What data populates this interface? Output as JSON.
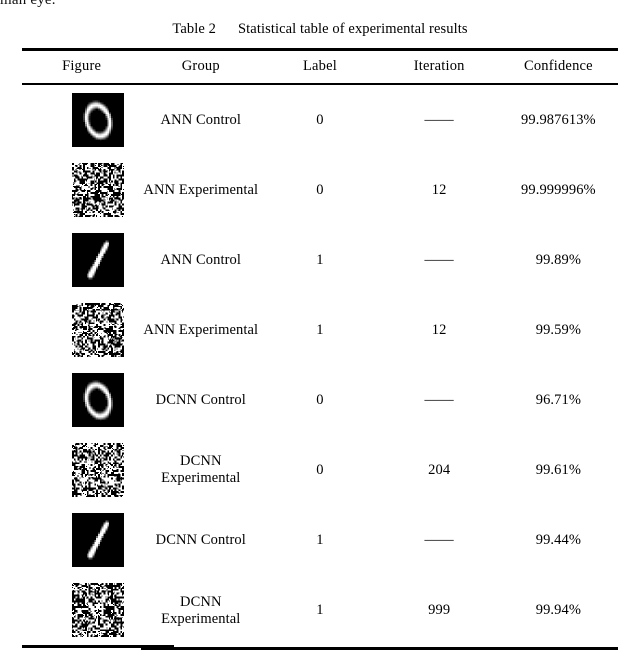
{
  "pretext": "man eye.",
  "caption": {
    "label": "Table 2",
    "title": "Statistical table of experimental results"
  },
  "table": {
    "columns": [
      "Figure",
      "Group",
      "Label",
      "Iteration",
      "Confidence"
    ],
    "rows": [
      {
        "figure": "digit-zero-clean",
        "group": "ANN Control",
        "label": "0",
        "iteration": "——",
        "confidence": "99.987613%"
      },
      {
        "figure": "digit-zero-adversarial-noise",
        "group": "ANN Experimental",
        "label": "0",
        "iteration": "12",
        "confidence": "99.999996%"
      },
      {
        "figure": "digit-one-clean",
        "group": "ANN Control",
        "label": "1",
        "iteration": "——",
        "confidence": "99.89%"
      },
      {
        "figure": "digit-one-adversarial-noise",
        "group": "ANN Experimental",
        "label": "1",
        "iteration": "12",
        "confidence": "99.59%"
      },
      {
        "figure": "digit-zero-clean",
        "group": "DCNN Control",
        "label": "0",
        "iteration": "——",
        "confidence": "96.71%"
      },
      {
        "figure": "digit-zero-adversarial-noise",
        "group": "DCNN Experimental",
        "label": "0",
        "iteration": "204",
        "confidence": "99.61%"
      },
      {
        "figure": "digit-one-clean",
        "group": "DCNN Control",
        "label": "1",
        "iteration": "——",
        "confidence": "99.44%"
      },
      {
        "figure": "digit-one-adversarial-noise",
        "group": "DCNN Experimental",
        "label": "1",
        "iteration": "999",
        "confidence": "99.94%"
      }
    ]
  },
  "colors": {
    "rule": "#000000",
    "text": "#000000",
    "figure_background_clean": "#000000",
    "figure_stroke_clean": "#ffffff",
    "figure_background_noise": "#ffffff",
    "figure_stroke_noise": "#000000"
  }
}
